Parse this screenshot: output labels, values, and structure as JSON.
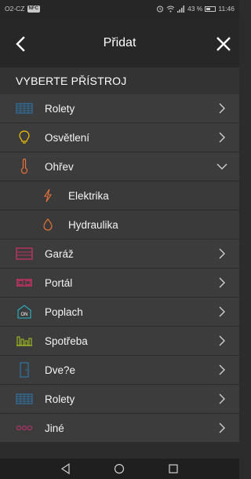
{
  "status_bar": {
    "carrier": "O2-CZ",
    "badge": "NFC",
    "signal_label": "43 %",
    "time": "11:46"
  },
  "header": {
    "title": "Přidat"
  },
  "section": {
    "title": "VYBERTE PŘÍSTROJ"
  },
  "items": [
    {
      "label": "Rolety",
      "icon": "blinds-icon",
      "color": "#2c7bb5",
      "expanded": false
    },
    {
      "label": "Osvětlení",
      "icon": "lightbulb-icon",
      "color": "#f2c400",
      "expanded": false
    },
    {
      "label": "Ohřev",
      "icon": "thermometer-icon",
      "color": "#e8733a",
      "expanded": true
    },
    {
      "label": "Elektrika",
      "icon": "lightning-icon",
      "color": "#e8733a",
      "sub": true
    },
    {
      "label": "Hydraulika",
      "icon": "droplet-icon",
      "color": "#e8733a",
      "sub": true
    },
    {
      "label": "Garáž",
      "icon": "garage-icon",
      "color": "#e0306b",
      "expanded": false
    },
    {
      "label": "Portál",
      "icon": "gate-icon",
      "color": "#e0306b",
      "expanded": false
    },
    {
      "label": "Poplach",
      "icon": "alarm-icon",
      "color": "#2cb5c8",
      "expanded": false
    },
    {
      "label": "Spotřeba",
      "icon": "consumption-icon",
      "color": "#a8c81e",
      "expanded": false
    },
    {
      "label": "Dve?e",
      "icon": "door-icon",
      "color": "#2c7bb5",
      "expanded": false
    },
    {
      "label": "Rolety",
      "icon": "blinds-icon",
      "color": "#2c7bb5",
      "expanded": false
    },
    {
      "label": "Jiné",
      "icon": "other-icon",
      "color": "#c8306e",
      "expanded": false
    }
  ]
}
